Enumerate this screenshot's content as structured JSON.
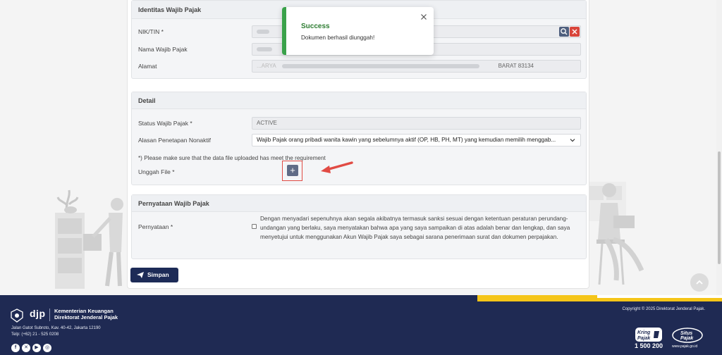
{
  "toast": {
    "title": "Success",
    "message": "Dokumen berhasil diunggah!"
  },
  "identitas": {
    "header": "Identitas Wajib Pajak",
    "nik_label": "NIK/TIN *",
    "nama_label": "Nama Wajib Pajak",
    "alamat_label": "Alamat",
    "alamat_prefix": "...ARYA",
    "alamat_suffix": "BARAT 83134"
  },
  "detail": {
    "header": "Detail",
    "status_label": "Status Wajib Pajak *",
    "status_value": "ACTIVE",
    "alasan_label": "Alasan Penetapan Nonaktif",
    "alasan_value": "Wajib Pajak orang pribadi wanita kawin yang sebelumnya aktif (OP, HB, PH, MT) yang kemudian memilih menggab...",
    "note": "*) Please make sure that the data file uploaded has meet the requirement",
    "unggah_label": "Unggah File *",
    "upload_glyph": "+"
  },
  "pernyataan": {
    "header": "Pernyataan Wajib Pajak",
    "label": "Pernyataan *",
    "text": "Dengan menyadari sepenuhnya akan segala akibatnya termasuk sanksi sesuai dengan ketentuan peraturan perundang-undangan yang berlaku, saya menyatakan bahwa apa yang saya sampaikan di atas adalah benar dan lengkap, dan saya menyetujui untuk menggunakan Akun Wajib Pajak saya sebagai sarana penerimaan surat dan dokumen perpajakan."
  },
  "actions": {
    "simpan_label": "Simpan"
  },
  "footer": {
    "logo_text": "djp",
    "ministry_line1": "Kementerian Keuangan",
    "ministry_line2": "Direktorat Jenderal Pajak",
    "address_line1": "Jalan Gatot Subroto, Kav. 40-42, Jakarta 12190",
    "address_line2": "Telp: (+62) 21 - 525 0208",
    "copyright": "Copyright © 2025 Direktorat Jenderal Pajak.",
    "kring_line1": "Kring",
    "kring_line2": "Pajak",
    "kring_number": "1 500 200",
    "situs_line1": "Situs",
    "situs_line2": "Pajak",
    "situs_url": "www.pajak.go.id"
  },
  "colors": {
    "primary": "#1d2b57",
    "footer": "#1f2a53",
    "success": "#3aa24a",
    "danger": "#d9453b",
    "accent_yellow": "#f5c518"
  }
}
